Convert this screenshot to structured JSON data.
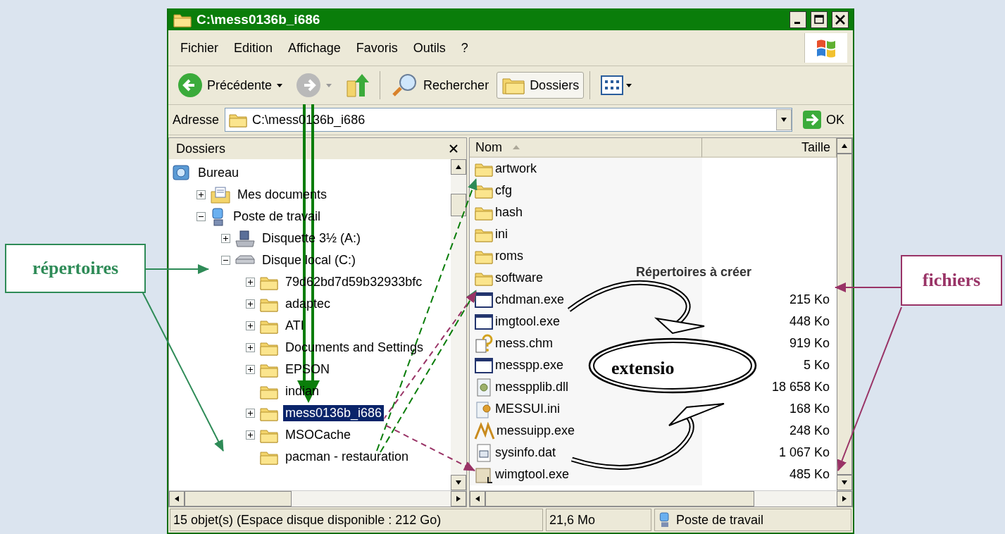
{
  "window": {
    "title": "C:\\mess0136b_i686"
  },
  "menu": [
    "Fichier",
    "Edition",
    "Affichage",
    "Favoris",
    "Outils",
    "?"
  ],
  "toolbar": {
    "back": {
      "label": "Précédente"
    },
    "forward": {
      "disabled": true
    },
    "search": {
      "label": "Rechercher"
    },
    "folders": {
      "label": "Dossiers",
      "selected": true
    }
  },
  "address": {
    "label": "Adresse",
    "value": "C:\\mess0136b_i686",
    "go": "OK"
  },
  "folders_pane": {
    "title": "Dossiers",
    "tree": [
      {
        "name": "Bureau",
        "kind": "desktop",
        "selected": false,
        "children": [
          {
            "name": "Mes documents",
            "kind": "documents",
            "expanded": false,
            "selected": false
          },
          {
            "name": "Poste de travail",
            "kind": "computer",
            "expanded": true,
            "selected": false,
            "children": [
              {
                "name": "Disquette 3½ (A:)",
                "kind": "floppy",
                "expanded": false,
                "selected": false
              },
              {
                "name": "Disque local (C:)",
                "kind": "drive",
                "expanded": true,
                "selected": false,
                "children": [
                  {
                    "name": "79d62bd7d59b32933bfc",
                    "kind": "folder",
                    "expanded": false,
                    "selected": false
                  },
                  {
                    "name": "adaptec",
                    "kind": "folder",
                    "expanded": false,
                    "selected": false
                  },
                  {
                    "name": "ATI",
                    "kind": "folder",
                    "expanded": false,
                    "selected": false
                  },
                  {
                    "name": "Documents and Settings",
                    "kind": "folder",
                    "expanded": false,
                    "selected": false
                  },
                  {
                    "name": "EPSON",
                    "kind": "folder",
                    "expanded": false,
                    "selected": false
                  },
                  {
                    "name": "indian",
                    "kind": "folder",
                    "selected": false
                  },
                  {
                    "name": "mess0136b_i686",
                    "kind": "folder",
                    "expanded": false,
                    "selected": true
                  },
                  {
                    "name": "MSOCache",
                    "kind": "folder",
                    "expanded": false,
                    "selected": false
                  },
                  {
                    "name": "pacman - restauration",
                    "kind": "folder",
                    "selected": false
                  }
                ]
              }
            ]
          }
        ]
      }
    ]
  },
  "file_list": {
    "columns": [
      {
        "label": "Nom",
        "sorted": true
      },
      {
        "label": "Taille",
        "sorted": false
      }
    ],
    "rows": [
      {
        "name": "artwork",
        "kind": "folder"
      },
      {
        "name": "cfg",
        "kind": "folder"
      },
      {
        "name": "hash",
        "kind": "folder"
      },
      {
        "name": "ini",
        "kind": "folder"
      },
      {
        "name": "roms",
        "kind": "folder"
      },
      {
        "name": "software",
        "kind": "folder"
      },
      {
        "name": "chdman.exe",
        "kind": "exe",
        "size": "215 Ko"
      },
      {
        "name": "imgtool.exe",
        "kind": "exe",
        "size": "448 Ko"
      },
      {
        "name": "mess.chm",
        "kind": "help",
        "size": "919 Ko"
      },
      {
        "name": "messpp.exe",
        "kind": "exe",
        "size": "5 Ko"
      },
      {
        "name": "messpplib.dll",
        "kind": "dll",
        "size": "18 658 Ko"
      },
      {
        "name": "MESSUI.ini",
        "kind": "ini",
        "size": "168 Ko"
      },
      {
        "name": "messuipp.exe",
        "kind": "app",
        "size": "248 Ko"
      },
      {
        "name": "sysinfo.dat",
        "kind": "dat",
        "size": "1 067 Ko"
      },
      {
        "name": "wimgtool.exe",
        "kind": "setup",
        "size": "485 Ko"
      }
    ]
  },
  "status_bar": [
    "15 objet(s) (Espace disque disponible : 212 Go)",
    "21,6 Mo",
    "Poste de travail"
  ],
  "annotations": {
    "callouts": [
      {
        "text": "répertoires",
        "color": "#2e8b57"
      },
      {
        "text": "fichiers",
        "color": "#993366"
      }
    ],
    "caption": "Répertoires à créer",
    "ellipse": "extensio"
  }
}
